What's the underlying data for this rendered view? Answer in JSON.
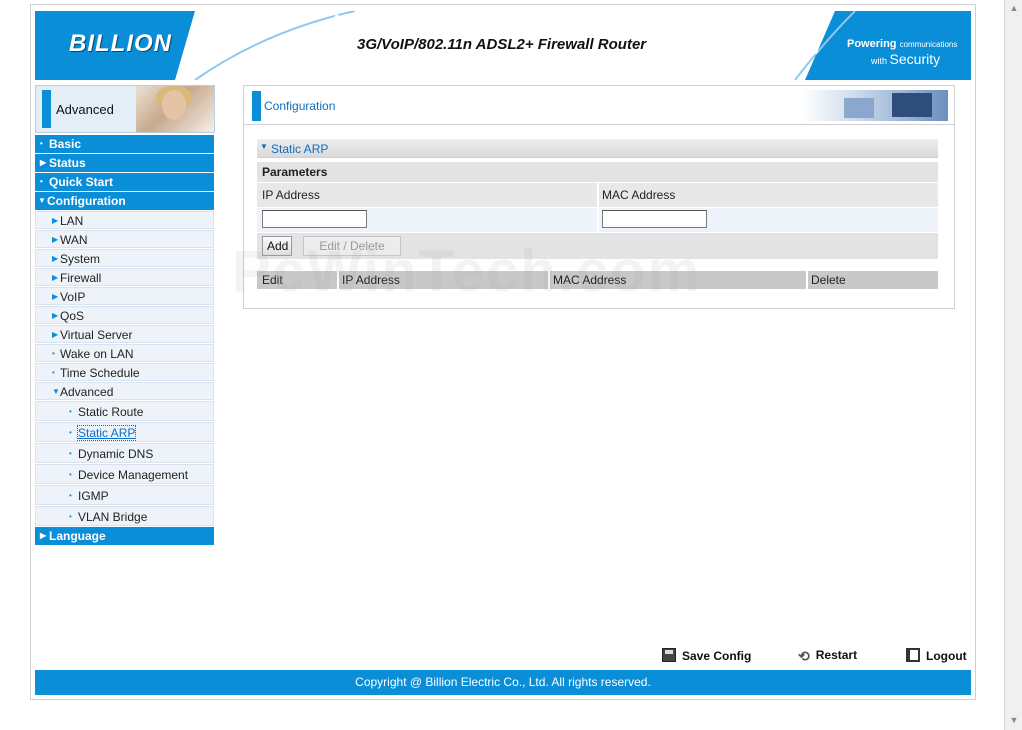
{
  "header": {
    "logo": "BILLION",
    "product_title": "3G/VoIP/802.11n ADSL2+ Firewall Router",
    "tagline_line1_bold": "Powering",
    "tagline_line1_small": "communications",
    "tagline_line2_small": "with",
    "tagline_line2_big": "Security"
  },
  "sidebar": {
    "banner_label": "Advanced",
    "top": {
      "basic": "Basic",
      "status": "Status",
      "quick_start": "Quick Start",
      "configuration": "Configuration",
      "language": "Language"
    },
    "config_items": [
      "LAN",
      "WAN",
      "System",
      "Firewall",
      "VoIP",
      "QoS",
      "Virtual Server",
      "Wake on LAN",
      "Time Schedule",
      "Advanced"
    ],
    "advanced_items": [
      "Static Route",
      "Static ARP",
      "Dynamic DNS",
      "Device Management",
      "IGMP",
      "VLAN Bridge"
    ]
  },
  "main": {
    "section_title": "Configuration",
    "panel_title": "Static ARP",
    "parameters_label": "Parameters",
    "ip_label": "IP Address",
    "mac_label": "MAC Address",
    "ip_value": "",
    "mac_value": "",
    "add_button": "Add",
    "edit_delete_button": "Edit / Delete",
    "table_headers": [
      "Edit",
      "IP Address",
      "MAC Address",
      "Delete"
    ]
  },
  "watermark": "PcWinTech.com",
  "footer": {
    "save_config": "Save Config",
    "restart": "Restart",
    "logout": "Logout",
    "copyright": "Copyright @ Billion Electric Co., Ltd. All rights reserved."
  },
  "colors": {
    "brand_blue": "#0a8ed8",
    "link_blue": "#0a6fc2"
  }
}
